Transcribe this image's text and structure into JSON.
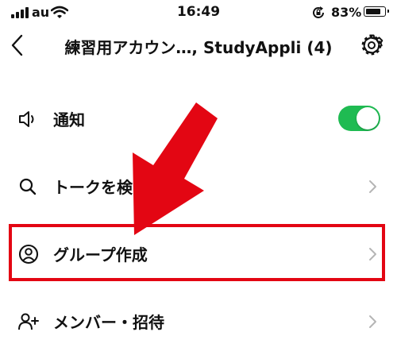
{
  "status_bar": {
    "carrier": "au",
    "time": "16:49",
    "battery_percent": "83%",
    "battery_level": 0.83,
    "icons": [
      "signal-icon",
      "wifi-icon",
      "rotation-lock-icon",
      "battery-icon"
    ]
  },
  "header": {
    "title": "練習用アカウン…, StudyAppli (4)",
    "back_icon": "chevron-left-icon",
    "settings_icon": "gear-icon"
  },
  "menu": {
    "items": [
      {
        "label": "通知",
        "icon": "speaker-icon",
        "control": "toggle",
        "toggle_on": true
      },
      {
        "label": "トークを検",
        "icon": "search-icon",
        "control": "chevron"
      },
      {
        "label": "グループ作成",
        "icon": "user-circle-icon",
        "control": "chevron",
        "highlighted": true
      },
      {
        "label": "メンバー・招待",
        "icon": "add-user-icon",
        "control": "chevron"
      }
    ]
  },
  "colors": {
    "toggle_on": "#1fbb52",
    "chevron": "#b5b5b5",
    "annotation_red": "#e30613",
    "text": "#111111"
  }
}
